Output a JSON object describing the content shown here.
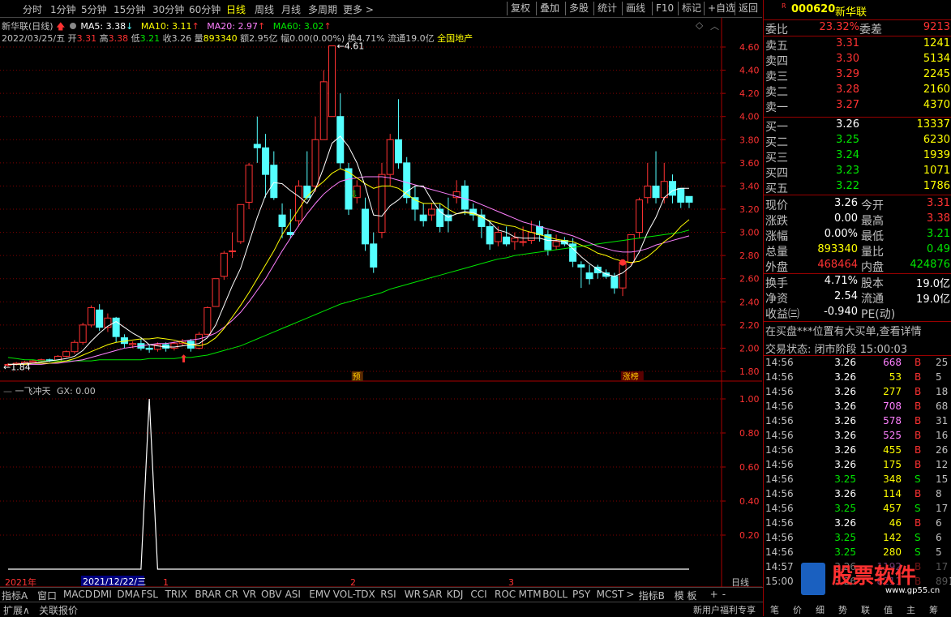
{
  "toolbar": {
    "periods": [
      "分时",
      "1分钟",
      "5分钟",
      "15分钟",
      "30分钟",
      "60分钟",
      "日线",
      "周线",
      "月线",
      "多周期",
      "更多 >"
    ],
    "active_period": "日线",
    "tools": [
      "复权",
      "叠加",
      "多股",
      "统计",
      "画线",
      "F10",
      "标记",
      "+自选",
      "返回"
    ]
  },
  "chart_header": {
    "title": "新华联(日线)",
    "ma5": "MA5: 3.38",
    "ma10": "MA10: 3.11",
    "ma20": "MA20: 2.97",
    "ma60": "MA60: 3.02",
    "date": "2022/03/25/五",
    "open_label": "开",
    "open": "3.31",
    "high_label": "高",
    "high": "3.38",
    "low_label": "低",
    "low": "3.21",
    "close_label": "收",
    "close": "3.26",
    "vol_label": "量",
    "vol": "893340",
    "amount": "额2.95亿",
    "amp": "幅0.00(0.00%)",
    "turnover": "换4.71%",
    "float": "流通19.0亿",
    "sector": "全国地产",
    "high_marker": "4.61",
    "low_marker": "1.84",
    "badge_pre": "预",
    "badge_limit": "涨榜"
  },
  "indicator": {
    "title": "一飞冲天",
    "value": "GX: 0.00",
    "yticks": [
      "1.00",
      "0.80",
      "0.60",
      "0.40",
      "0.20"
    ]
  },
  "price_axis": [
    "4.60",
    "4.40",
    "4.20",
    "4.00",
    "3.80",
    "3.60",
    "3.40",
    "3.20",
    "3.00",
    "2.80",
    "2.60",
    "2.40",
    "2.20",
    "2.00",
    "1.80"
  ],
  "time_axis": {
    "year": "2021年",
    "date_box": "2021/12/22/三",
    "m1": "1",
    "m2": "2",
    "m3": "3",
    "period": "日线"
  },
  "indicator_tabs": [
    "指标A",
    "窗口",
    "MACD",
    "DMI",
    "DMA",
    "FSL",
    "TRIX",
    "BRAR",
    "CR",
    "VR",
    "OBV",
    "ASI",
    "EMV",
    "VOL-TDX",
    "RSI",
    "WR",
    "SAR",
    "KDJ",
    "CCI",
    "ROC",
    "MTM",
    "BOLL",
    "PSY",
    "MCST",
    ">",
    "指标B",
    "模 板",
    "+",
    "-"
  ],
  "bottom_bar": {
    "left1": "扩展∧",
    "left2": "关联报价",
    "notice": "新用户福利专享",
    "btns": [
      "笔",
      "价",
      "细",
      "势",
      "联",
      "值",
      "主",
      "筹"
    ]
  },
  "quote": {
    "code": "000620",
    "name": "新华联",
    "webi_label": "委比",
    "webi": "23.32%",
    "weicha_label": "委差",
    "weicha": "9213",
    "asks": [
      {
        "label": "卖五",
        "price": "3.31",
        "vol": "1241"
      },
      {
        "label": "卖四",
        "price": "3.30",
        "vol": "5134"
      },
      {
        "label": "卖三",
        "price": "3.29",
        "vol": "2245"
      },
      {
        "label": "卖二",
        "price": "3.28",
        "vol": "2160"
      },
      {
        "label": "卖一",
        "price": "3.27",
        "vol": "4370"
      }
    ],
    "bids": [
      {
        "label": "买一",
        "price": "3.26",
        "vol": "13337"
      },
      {
        "label": "买二",
        "price": "3.25",
        "vol": "6230"
      },
      {
        "label": "买三",
        "price": "3.24",
        "vol": "1939"
      },
      {
        "label": "买四",
        "price": "3.23",
        "vol": "1071"
      },
      {
        "label": "买五",
        "price": "3.22",
        "vol": "1786"
      }
    ],
    "stats": [
      {
        "l1": "现价",
        "v1": "3.26",
        "l2": "今开",
        "v2": "3.31"
      },
      {
        "l1": "涨跌",
        "v1": "0.00",
        "l2": "最高",
        "v2": "3.38"
      },
      {
        "l1": "涨幅",
        "v1": "0.00%",
        "l2": "最低",
        "v2": "3.21"
      },
      {
        "l1": "总量",
        "v1": "893340",
        "l2": "量比",
        "v2": "0.49"
      },
      {
        "l1": "外盘",
        "v1": "468464",
        "l2": "内盘",
        "v2": "424876"
      }
    ],
    "stats2": [
      {
        "l1": "换手",
        "v1": "4.71%",
        "l2": "股本",
        "v2": "19.0亿"
      },
      {
        "l1": "净资",
        "v1": "2.54",
        "l2": "流通",
        "v2": "19.0亿"
      },
      {
        "l1": "收益㈢",
        "v1": "-0.940",
        "l2": "PE(动)",
        "v2": ""
      }
    ],
    "notice": "在买盘***位置有大买单,查看详情",
    "status": "交易状态: 闭市阶段 15:00:03",
    "ticks": [
      {
        "t": "14:56",
        "p": "3.26",
        "v": "668",
        "bs": "B",
        "n": "25"
      },
      {
        "t": "14:56",
        "p": "3.26",
        "v": "53",
        "bs": "B",
        "n": "5"
      },
      {
        "t": "14:56",
        "p": "3.26",
        "v": "277",
        "bs": "B",
        "n": "18"
      },
      {
        "t": "14:56",
        "p": "3.26",
        "v": "708",
        "bs": "B",
        "n": "68"
      },
      {
        "t": "14:56",
        "p": "3.26",
        "v": "578",
        "bs": "B",
        "n": "31"
      },
      {
        "t": "14:56",
        "p": "3.26",
        "v": "525",
        "bs": "B",
        "n": "16"
      },
      {
        "t": "14:56",
        "p": "3.26",
        "v": "455",
        "bs": "B",
        "n": "26"
      },
      {
        "t": "14:56",
        "p": "3.26",
        "v": "175",
        "bs": "B",
        "n": "12"
      },
      {
        "t": "14:56",
        "p": "3.25",
        "v": "348",
        "bs": "S",
        "n": "15"
      },
      {
        "t": "14:56",
        "p": "3.26",
        "v": "114",
        "bs": "B",
        "n": "8"
      },
      {
        "t": "14:56",
        "p": "3.25",
        "v": "457",
        "bs": "S",
        "n": "17"
      },
      {
        "t": "14:56",
        "p": "3.26",
        "v": "46",
        "bs": "B",
        "n": "6"
      },
      {
        "t": "14:56",
        "p": "3.25",
        "v": "142",
        "bs": "S",
        "n": "6"
      },
      {
        "t": "14:56",
        "p": "3.25",
        "v": "280",
        "bs": "S",
        "n": "5"
      },
      {
        "t": "14:57",
        "p": "3.26",
        "v": "1192",
        "bs": "B",
        "n": "17"
      },
      {
        "t": "15:00",
        "p": "3.26",
        "v": "8211",
        "bs": "B",
        "n": "891"
      }
    ],
    "watermark": "股票软件",
    "watermark_url": "www.gp55.cn"
  },
  "colors": {
    "up": "#ff3232",
    "down": "#54ffff",
    "ma5": "#ffffff",
    "ma10": "#ffff00",
    "ma20": "#ff80ff",
    "ma60": "#00e600",
    "grid": "#800000"
  },
  "chart_data": {
    "type": "candlestick",
    "ylim": [
      1.8,
      4.7
    ],
    "candles": [
      [
        1.86,
        1.86,
        1.84,
        1.87
      ],
      [
        1.86,
        1.87,
        1.85,
        1.88
      ],
      [
        1.87,
        1.88,
        1.86,
        1.89
      ],
      [
        1.88,
        1.89,
        1.87,
        1.9
      ],
      [
        1.89,
        1.9,
        1.88,
        1.91
      ],
      [
        1.9,
        1.89,
        1.88,
        1.91
      ],
      [
        1.89,
        1.93,
        1.88,
        1.94
      ],
      [
        1.93,
        1.97,
        1.92,
        1.98
      ],
      [
        1.97,
        2.05,
        1.95,
        2.07
      ],
      [
        2.05,
        2.2,
        2.03,
        2.22
      ],
      [
        2.2,
        2.35,
        2.18,
        2.37
      ],
      [
        2.33,
        2.18,
        2.15,
        2.38
      ],
      [
        2.18,
        2.26,
        2.14,
        2.3
      ],
      [
        2.26,
        2.1,
        2.05,
        2.27
      ],
      [
        2.09,
        2.04,
        2.0,
        2.12
      ],
      [
        2.03,
        2.04,
        2.0,
        2.06
      ],
      [
        2.04,
        2.0,
        1.98,
        2.08
      ],
      [
        2.0,
        1.99,
        1.96,
        2.03
      ],
      [
        1.99,
        2.03,
        1.97,
        2.05
      ],
      [
        2.03,
        2.0,
        1.97,
        2.05
      ],
      [
        2.0,
        2.04,
        1.98,
        2.06
      ],
      [
        2.04,
        2.06,
        2.02,
        2.08
      ],
      [
        2.06,
        2.0,
        1.97,
        2.08
      ],
      [
        2.0,
        2.12,
        1.99,
        2.14
      ],
      [
        2.12,
        2.35,
        2.11,
        2.36
      ],
      [
        2.36,
        2.6,
        2.36,
        2.6
      ],
      [
        2.62,
        2.82,
        2.59,
        2.84
      ],
      [
        2.84,
        2.84,
        2.78,
        3.0
      ],
      [
        2.92,
        3.24,
        2.9,
        3.24
      ],
      [
        3.26,
        3.58,
        3.2,
        3.6
      ],
      [
        3.76,
        3.73,
        3.6,
        4.0
      ],
      [
        3.73,
        3.5,
        3.3,
        3.85
      ],
      [
        3.58,
        3.3,
        3.28,
        3.7
      ],
      [
        3.15,
        3.05,
        2.95,
        3.25
      ],
      [
        3.0,
        2.98,
        2.95,
        3.2
      ],
      [
        3.1,
        3.4,
        3.05,
        3.45
      ],
      [
        3.4,
        3.3,
        3.28,
        3.7
      ],
      [
        3.4,
        3.8,
        3.35,
        4.0
      ],
      [
        3.8,
        4.3,
        3.8,
        4.4
      ],
      [
        4.0,
        4.61,
        4.0,
        4.61
      ],
      [
        4.0,
        3.6,
        3.55,
        4.2
      ],
      [
        3.55,
        3.2,
        3.15,
        3.6
      ],
      [
        3.3,
        3.4,
        3.25,
        3.45
      ],
      [
        3.2,
        2.9,
        2.84,
        3.3
      ],
      [
        2.9,
        2.7,
        2.65,
        3.0
      ],
      [
        3.0,
        3.5,
        2.95,
        3.6
      ],
      [
        3.5,
        3.8,
        3.4,
        3.85
      ],
      [
        3.8,
        3.6,
        3.55,
        4.15
      ],
      [
        3.6,
        3.3,
        3.25,
        3.65
      ],
      [
        3.3,
        3.2,
        3.1,
        3.4
      ],
      [
        3.15,
        3.1,
        3.05,
        3.25
      ],
      [
        3.15,
        3.2,
        3.1,
        3.25
      ],
      [
        3.2,
        3.05,
        3.0,
        3.25
      ],
      [
        3.15,
        3.1,
        3.0,
        3.3
      ],
      [
        3.3,
        3.35,
        3.25,
        3.45
      ],
      [
        3.4,
        3.2,
        3.15,
        3.45
      ],
      [
        3.2,
        3.15,
        3.1,
        3.25
      ],
      [
        3.15,
        3.05,
        2.95,
        3.2
      ],
      [
        3.05,
        2.9,
        2.85,
        3.1
      ],
      [
        2.92,
        3.0,
        2.88,
        3.05
      ],
      [
        2.96,
        2.9,
        2.88,
        3.05
      ],
      [
        2.92,
        2.95,
        2.85,
        3.0
      ],
      [
        2.92,
        2.92,
        2.88,
        3.05
      ],
      [
        2.93,
        3.0,
        2.9,
        3.1
      ],
      [
        3.05,
        2.98,
        2.92,
        3.1
      ],
      [
        2.98,
        2.85,
        2.8,
        3.02
      ],
      [
        2.88,
        2.92,
        2.85,
        2.98
      ],
      [
        2.93,
        2.9,
        2.88,
        2.96
      ],
      [
        2.9,
        2.75,
        2.7,
        2.95
      ],
      [
        2.72,
        2.7,
        2.52,
        2.75
      ],
      [
        2.65,
        2.6,
        2.55,
        2.72
      ],
      [
        2.7,
        2.65,
        2.6,
        2.72
      ],
      [
        2.65,
        2.62,
        2.6,
        2.68
      ],
      [
        2.62,
        2.52,
        2.47,
        2.65
      ],
      [
        2.52,
        2.74,
        2.45,
        2.76
      ],
      [
        2.74,
        2.98,
        2.72,
        2.98
      ],
      [
        3.0,
        3.28,
        2.95,
        3.3
      ],
      [
        3.3,
        3.4,
        3.25,
        3.6
      ],
      [
        3.4,
        3.3,
        3.25,
        3.7
      ],
      [
        3.3,
        3.44,
        3.25,
        3.6
      ],
      [
        3.44,
        3.32,
        3.25,
        3.5
      ],
      [
        3.38,
        3.26,
        3.21,
        3.38
      ],
      [
        3.31,
        3.26,
        3.21,
        3.3
      ]
    ],
    "ma5": [
      1.86,
      1.86,
      1.87,
      1.87,
      1.88,
      1.89,
      1.9,
      1.91,
      1.93,
      1.98,
      2.06,
      2.13,
      2.19,
      2.23,
      2.18,
      2.13,
      2.09,
      2.03,
      2.02,
      2.01,
      2.01,
      2.02,
      2.03,
      2.04,
      2.09,
      2.2,
      2.37,
      2.54,
      2.69,
      2.91,
      3.13,
      3.32,
      3.43,
      3.42,
      3.36,
      3.31,
      3.25,
      3.37,
      3.56,
      3.77,
      3.83,
      3.74,
      3.6,
      3.4,
      3.15,
      3.14,
      3.23,
      3.28,
      3.35,
      3.4,
      3.4,
      3.28,
      3.18,
      3.13,
      3.16,
      3.18,
      3.17,
      3.14,
      3.09,
      3.02,
      3.0,
      2.96,
      2.95,
      2.95,
      2.95,
      2.93,
      2.93,
      2.92,
      2.86,
      2.79,
      2.73,
      2.68,
      2.64,
      2.62,
      2.65,
      2.71,
      2.83,
      3.0,
      3.13,
      3.3,
      3.36,
      3.38,
      3.38
    ],
    "ma10": [
      1.86,
      1.86,
      1.86,
      1.87,
      1.87,
      1.87,
      1.88,
      1.89,
      1.91,
      1.94,
      1.97,
      2.0,
      2.03,
      2.05,
      2.06,
      2.07,
      2.08,
      2.08,
      2.09,
      2.08,
      2.07,
      2.05,
      2.03,
      2.02,
      2.04,
      2.09,
      2.17,
      2.27,
      2.37,
      2.48,
      2.6,
      2.72,
      2.84,
      2.98,
      3.09,
      3.2,
      3.31,
      3.38,
      3.44,
      3.51,
      3.55,
      3.52,
      3.47,
      3.42,
      3.38,
      3.4,
      3.4,
      3.38,
      3.33,
      3.28,
      3.25,
      3.25,
      3.25,
      3.2,
      3.16,
      3.17,
      3.16,
      3.13,
      3.1,
      3.08,
      3.06,
      3.05,
      3.02,
      3.0,
      2.98,
      2.96,
      2.94,
      2.93,
      2.92,
      2.89,
      2.86,
      2.82,
      2.8,
      2.77,
      2.75,
      2.74,
      2.75,
      2.79,
      2.85,
      2.92,
      2.97,
      3.05,
      3.11
    ],
    "ma20": [
      1.86,
      1.86,
      1.86,
      1.86,
      1.86,
      1.87,
      1.87,
      1.88,
      1.89,
      1.9,
      1.92,
      1.94,
      1.96,
      1.98,
      2.0,
      2.01,
      2.02,
      2.03,
      2.04,
      2.04,
      2.05,
      2.06,
      2.07,
      2.08,
      2.1,
      2.13,
      2.18,
      2.24,
      2.31,
      2.4,
      2.5,
      2.6,
      2.72,
      2.84,
      2.95,
      3.06,
      3.16,
      3.25,
      3.33,
      3.39,
      3.44,
      3.46,
      3.47,
      3.48,
      3.48,
      3.48,
      3.47,
      3.45,
      3.43,
      3.41,
      3.39,
      3.37,
      3.35,
      3.33,
      3.31,
      3.29,
      3.27,
      3.24,
      3.21,
      3.18,
      3.15,
      3.12,
      3.09,
      3.07,
      3.05,
      3.03,
      3.01,
      2.99,
      2.97,
      2.94,
      2.91,
      2.88,
      2.86,
      2.84,
      2.83,
      2.83,
      2.84,
      2.86,
      2.89,
      2.91,
      2.93,
      2.95,
      2.97
    ],
    "ma60": [
      1.92,
      1.91,
      1.9,
      1.9,
      1.89,
      1.89,
      1.89,
      1.89,
      1.89,
      1.89,
      1.89,
      1.9,
      1.9,
      1.9,
      1.9,
      1.9,
      1.9,
      1.91,
      1.91,
      1.91,
      1.91,
      1.92,
      1.92,
      1.93,
      1.94,
      1.96,
      1.98,
      2.0,
      2.02,
      2.05,
      2.08,
      2.11,
      2.14,
      2.17,
      2.2,
      2.23,
      2.26,
      2.29,
      2.32,
      2.35,
      2.38,
      2.4,
      2.42,
      2.44,
      2.46,
      2.48,
      2.51,
      2.53,
      2.55,
      2.57,
      2.59,
      2.61,
      2.63,
      2.65,
      2.67,
      2.69,
      2.71,
      2.73,
      2.75,
      2.77,
      2.78,
      2.8,
      2.81,
      2.82,
      2.83,
      2.84,
      2.85,
      2.86,
      2.87,
      2.88,
      2.89,
      2.9,
      2.91,
      2.92,
      2.93,
      2.94,
      2.95,
      2.96,
      2.97,
      2.98,
      2.99,
      3.0,
      3.02
    ],
    "signal": {
      "spike_index": 15,
      "spike_value": 1.0
    }
  }
}
